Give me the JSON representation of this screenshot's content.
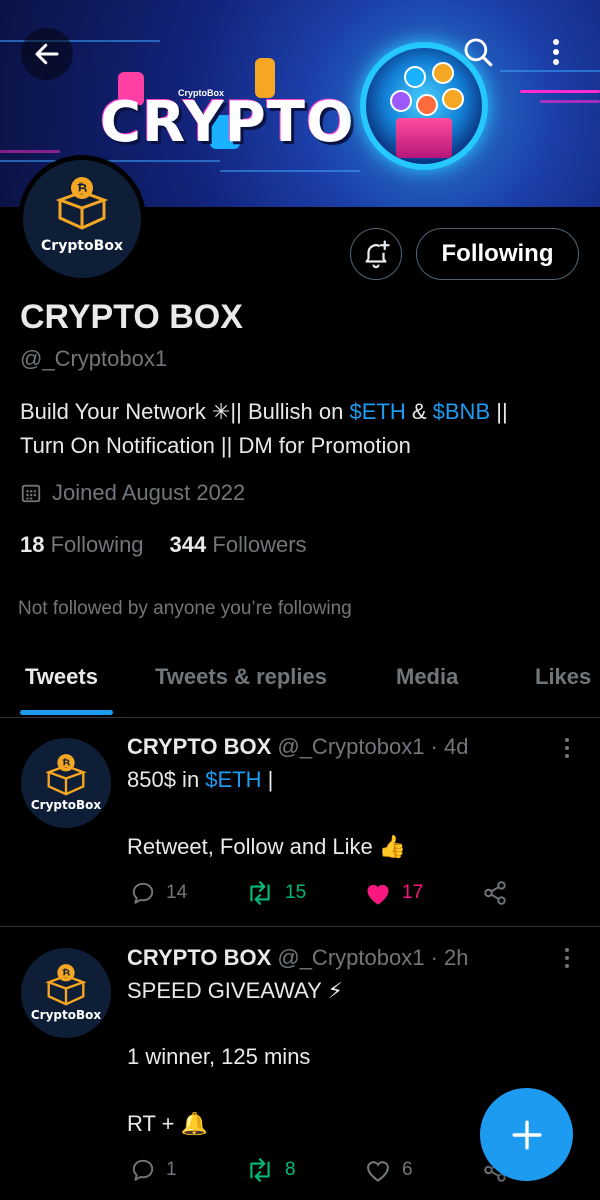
{
  "banner": {
    "title": "CRYPTO",
    "small_label": "CryptoBox"
  },
  "header": {
    "back_icon": "arrow-left-icon",
    "search_icon": "search-icon",
    "more_icon": "more-vertical-icon"
  },
  "profile": {
    "avatar_label": "CryptoBox",
    "name": "CRYPTO BOX",
    "handle": "@_Cryptobox1",
    "bio_line1_a": "Build Your Network ✳|| Bullish on ",
    "bio_link1": "$ETH",
    "bio_line1_b": " & ",
    "bio_link2": "$BNB",
    "bio_line1_c": " ||",
    "bio_line2": "Turn On Notification || DM for Promotion",
    "joined": "Joined August 2022",
    "following_count": "18",
    "following_label": "Following",
    "followers_count": "344",
    "followers_label": "Followers",
    "not_followed": "Not followed by anyone you’re following",
    "follow_button": "Following",
    "notify_icon": "bell-plus-icon"
  },
  "tabs": [
    {
      "label": "Tweets",
      "active": true
    },
    {
      "label": "Tweets & replies",
      "active": false
    },
    {
      "label": "Media",
      "active": false
    },
    {
      "label": "Likes",
      "active": false
    }
  ],
  "tweets": [
    {
      "avatar_label": "CryptoBox",
      "name": "CRYPTO BOX",
      "meta": " @_Cryptobox1 · 4d",
      "line1_a": "850$ in ",
      "line1_link": "$ETH",
      "line1_b": " |",
      "line2": "",
      "line3": "Retweet, Follow and Like 👍",
      "replies": "14",
      "retweets": "15",
      "likes": "17",
      "liked": true
    },
    {
      "avatar_label": "CryptoBox",
      "name": "CRYPTO BOX",
      "meta": " @_Cryptobox1 · 2h",
      "line1": "SPEED GIVEAWAY ⚡",
      "line2": "1 winner, 125 mins",
      "line3": "RT + 🔔",
      "replies": "1",
      "retweets": "8",
      "likes": "6",
      "liked": false
    }
  ],
  "fab": {
    "icon": "plus-icon"
  },
  "colors": {
    "accent": "#1d9bf0",
    "retweet": "#00ba7c",
    "like": "#f91880",
    "muted": "#71767b",
    "background": "#000000"
  }
}
